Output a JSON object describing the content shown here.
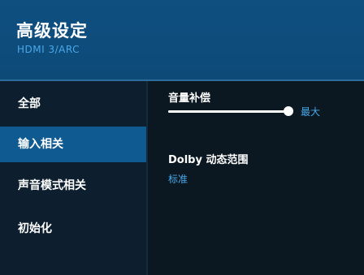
{
  "header": {
    "title": "高级设定",
    "subtitle": "HDMI 3/ARC"
  },
  "sidebar": {
    "items": [
      {
        "label": "全部",
        "selected": false
      },
      {
        "label": "输入相关",
        "selected": true
      },
      {
        "label": "声音模式相关",
        "selected": false
      },
      {
        "label": "初始化",
        "selected": false
      }
    ]
  },
  "main": {
    "volume_compensation": {
      "label": "音量补偿",
      "value_label": "最大",
      "level_fraction": 1.0
    },
    "dolby_drc": {
      "label": "Dolby 动态范围",
      "value": "标准"
    }
  },
  "colors": {
    "header_bg": "#0e4f80",
    "selected_item_bg": "#0f5a90",
    "accent_text": "#4aa8e8",
    "sidebar_bg": "#0d1f2e",
    "main_bg": "#0b1822"
  }
}
